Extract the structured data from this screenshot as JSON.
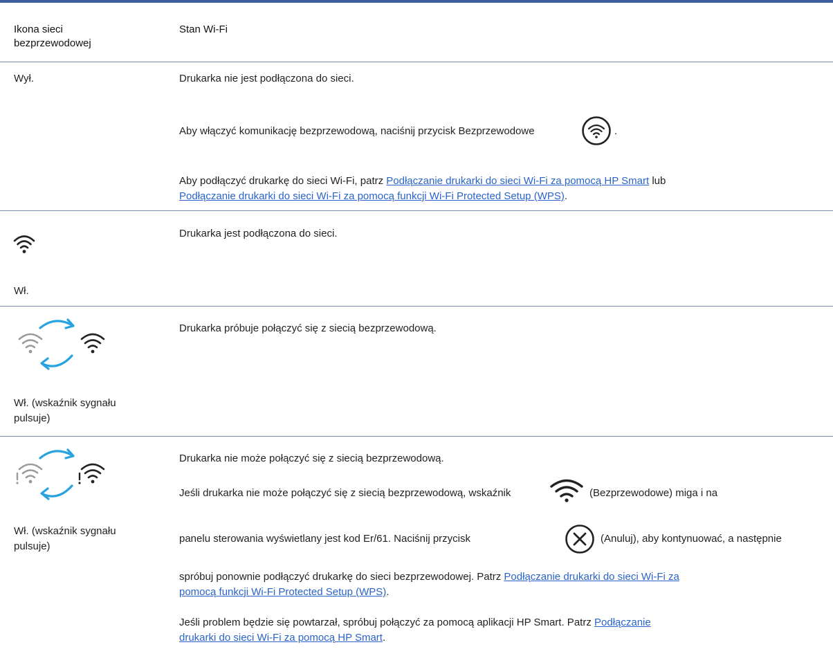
{
  "header": {
    "col1": "Ikona sieci bezprzewodowej",
    "col2": "Stan Wi-Fi"
  },
  "rows": [
    {
      "state_label": "Wył.",
      "lines": [
        "Drukarka nie jest podłączona do sieci.",
        "Aby włączyć komunikację bezprzewodową, naciśnij przycisk Bezprzewodowe",
        "."
      ],
      "p3_prefix": "Aby podłączyć drukarkę do sieci Wi-Fi, patrz ",
      "p3_link1": "Podłączanie drukarki do sieci Wi-Fi za pomocą HP Smart",
      "p3_mid": " lub",
      "p3_link2": "Podłączanie drukarki do sieci Wi-Fi za pomocą funkcji Wi-Fi Protected Setup (WPS)",
      "p3_end": "."
    },
    {
      "state_label": "Wł.",
      "lines": [
        "Drukarka jest podłączona do sieci."
      ]
    },
    {
      "state_label": "Wł. (wskaźnik sygnału pulsuje)",
      "lines": [
        "Drukarka próbuje połączyć się z siecią bezprzewodową."
      ]
    },
    {
      "state_label": "Wł. (wskaźnik sygnału pulsuje)",
      "lines": [
        "Drukarka nie może połączyć się z siecią bezprzewodową.",
        "Jeśli drukarka nie może połączyć się z siecią bezprzewodową, wskaźnik",
        "(Bezprzewodowe) miga i na",
        "panelu sterowania wyświetlany jest kod Er/61. Naciśnij przycisk",
        "(Anuluj), aby kontynuować, a następnie",
        "spróbuj ponownie podłączyć drukarkę do sieci bezprzewodowej. Patrz "
      ],
      "link_a": "Podłączanie drukarki do sieci Wi-Fi za",
      "link_a2": "pomocą funkcji Wi-Fi Protected Setup (WPS)",
      "link_a_end": ".",
      "p4_prefix": "Jeśli problem będzie się powtarzał, spróbuj połączyć za pomocą aplikacji HP Smart. Patrz ",
      "link_b": "Podłączanie",
      "link_b2": "drukarki do sieci Wi-Fi za pomocą HP Smart",
      "link_b_end": "."
    }
  ],
  "icons": {
    "wifi": "wifi-icon",
    "wifi_button": "wireless-button-icon",
    "cancel_button": "cancel-button-icon",
    "connecting": "wifi-connecting-icon",
    "error": "wifi-error-icon"
  },
  "colors": {
    "rule": "#3f5fa0",
    "link": "#2a64c8",
    "arrow": "#29a3e0"
  }
}
